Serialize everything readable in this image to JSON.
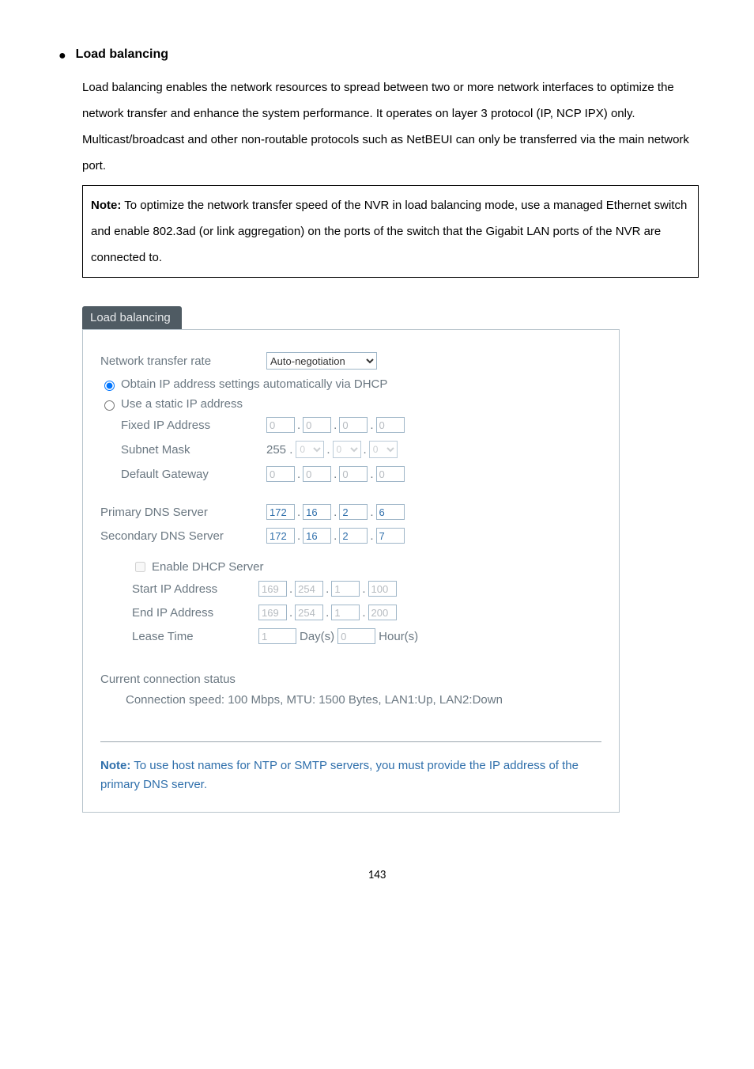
{
  "heading": "Load balancing",
  "intro": "Load balancing enables the network resources to spread between two or more network interfaces to optimize the network transfer and enhance the system performance.   It operates on layer 3 protocol (IP, NCP IPX) only.   Multicast/broadcast and other non-routable protocols such as NetBEUI can only be transferred via the main network port.",
  "note_label": "Note:",
  "note_body": " To optimize the network transfer speed of the NVR in load balancing mode, use a managed Ethernet switch and enable 802.3ad (or link aggregation) on the ports of the switch that the Gigabit LAN ports of the NVR are connected to.",
  "panel": {
    "tab": "Load balancing",
    "ntr_label": "Network transfer rate",
    "ntr_value": "Auto-negotiation",
    "radio_dhcp": "Obtain IP address settings automatically via DHCP",
    "radio_static": "Use a static IP address",
    "fixed_ip_label": "Fixed IP Address",
    "fixed_ip": [
      "0",
      "0",
      "0",
      "0"
    ],
    "subnet_label": "Subnet Mask",
    "subnet_prefix": "255 .",
    "subnet": [
      "0",
      "0",
      "0"
    ],
    "gateway_label": "Default Gateway",
    "gateway": [
      "0",
      "0",
      "0",
      "0"
    ],
    "pdns_label": "Primary DNS Server",
    "pdns": [
      "172",
      "16",
      "2",
      "6"
    ],
    "sdns_label": "Secondary DNS Server",
    "sdns": [
      "172",
      "16",
      "2",
      "7"
    ],
    "dhcp_enable": "Enable DHCP Server",
    "start_ip_label": "Start IP Address",
    "start_ip": [
      "169",
      "254",
      "1",
      "100"
    ],
    "end_ip_label": "End IP Address",
    "end_ip": [
      "169",
      "254",
      "1",
      "200"
    ],
    "lease_label": "Lease Time",
    "lease_days": "1",
    "lease_days_unit": "Day(s)",
    "lease_hours": "0",
    "lease_hours_unit": "Hour(s)",
    "status_heading": "Current connection status",
    "status_text": "Connection speed: 100 Mbps, MTU: 1500 Bytes, LAN1:Up, LAN2:Down",
    "bottom_note_label": "Note:",
    "bottom_note_body": " To use host names for NTP or SMTP servers, you must provide the IP address of the primary DNS server."
  },
  "page_number": "143"
}
